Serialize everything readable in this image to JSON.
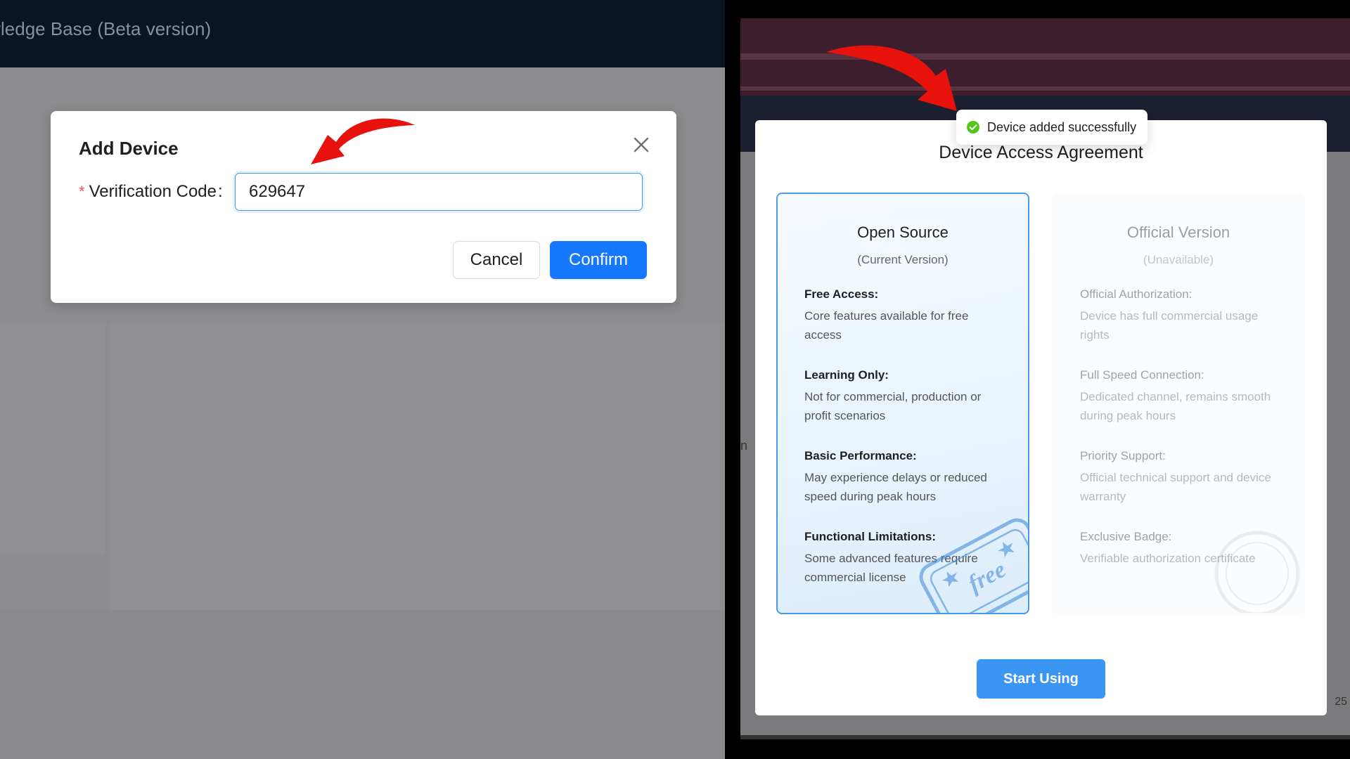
{
  "left": {
    "app_title": "vledge Base (Beta version)",
    "dialog": {
      "title": "Add Device",
      "required_mark": "*",
      "field_label": "Verification Code",
      "field_colon": ":",
      "field_value": "629647",
      "cancel_label": "Cancel",
      "confirm_label": "Confirm"
    }
  },
  "right": {
    "ghost_left": "n",
    "ghost_right": "25",
    "toast": {
      "text": "Device added successfully"
    },
    "dialog": {
      "title": "Device Access Agreement",
      "start_label": "Start Using",
      "open_source": {
        "title": "Open Source",
        "subtitle": "(Current Version)",
        "stamp_text": "free",
        "features": [
          {
            "heading": "Free Access:",
            "desc": "Core features available for free access"
          },
          {
            "heading": "Learning Only:",
            "desc": "Not for commercial, production or profit scenarios"
          },
          {
            "heading": "Basic Performance:",
            "desc": "May experience delays or reduced speed during peak hours"
          },
          {
            "heading": "Functional Limitations:",
            "desc": "Some advanced features require commercial license"
          }
        ]
      },
      "official": {
        "title": "Official Version",
        "subtitle": "(Unavailable)",
        "features": [
          {
            "heading": "Official Authorization:",
            "desc": "Device has full commercial usage rights"
          },
          {
            "heading": "Full Speed Connection:",
            "desc": "Dedicated channel, remains smooth during peak hours"
          },
          {
            "heading": "Priority Support:",
            "desc": "Official technical support and device warranty"
          },
          {
            "heading": "Exclusive Badge:",
            "desc": "Verifiable authorization certificate"
          }
        ]
      }
    }
  },
  "colors": {
    "primary": "#1677ff",
    "start_button": "#3b95f2",
    "success": "#52c41a",
    "annotation_arrow": "#e8120c",
    "required": "#ff4d4f"
  },
  "icons": {
    "close": "close-icon",
    "success": "check-circle-icon",
    "annotation": "red-arrow-icon",
    "stamp": "free-stamp-icon"
  }
}
